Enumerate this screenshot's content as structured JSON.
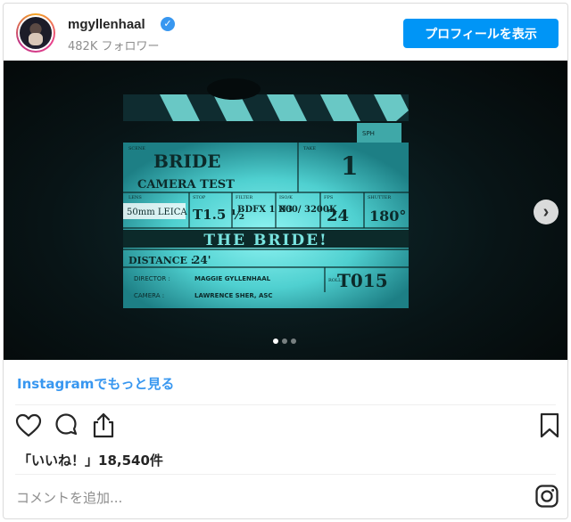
{
  "header": {
    "username": "mgyllenhaal",
    "verified_icon": "verified-badge-icon",
    "followers": "482K フォロワー",
    "profile_button": "プロフィールを表示"
  },
  "media": {
    "slate": {
      "scene_label": "SCENE",
      "take_label": "TAKE",
      "roll_label": "ROLL",
      "scene_value": "BRIDE",
      "take_value": "1",
      "camera_test": "CAMERA TEST",
      "sph": "SPH",
      "lens_label": "LENS",
      "stop_label": "STOP",
      "filter_label": "FILTER",
      "iso_label": "ISO/K",
      "fps_label": "FPS",
      "shutter_label": "SHUTTER",
      "lens_value": "50mm LEICA",
      "stop_value": "T1.5 ½",
      "filter_value": "BDFX 1 N3",
      "iso_value": "800/ 3200K",
      "fps_value": "24",
      "shutter_value": "180°",
      "title": "THE BRIDE!",
      "distance_label": "DISTANCE :",
      "distance_value": "24'",
      "director_label": "DIRECTOR :",
      "director_value": "MAGGIE GYLLENHAAL",
      "camera_label": "CAMERA :",
      "camera_value": "LAWRENCE SHER, ASC",
      "roll_value": "T015"
    },
    "next_icon": "chevron-right-icon",
    "carousel_total": 3,
    "carousel_active": 1
  },
  "links": {
    "more_on_instagram": "Instagramでもっと見る"
  },
  "actions": {
    "like_icon": "heart-icon",
    "comment_icon": "comment-icon",
    "share_icon": "share-icon",
    "save_icon": "bookmark-icon"
  },
  "likes": {
    "text": "「いいね！」18,540件"
  },
  "comment": {
    "placeholder": "コメントを追加..."
  },
  "footer": {
    "instagram_icon": "instagram-logo-icon"
  },
  "colors": {
    "accent": "#0095f6",
    "link": "#3897f0",
    "slate_glow": "#5fe0e0"
  }
}
